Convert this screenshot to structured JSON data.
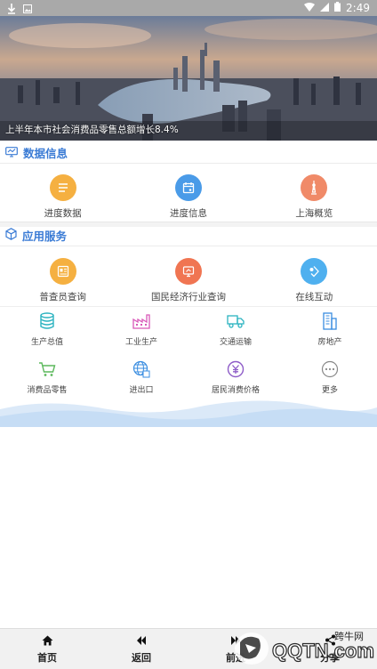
{
  "status": {
    "time": "2:49"
  },
  "banner": {
    "caption": "上半年本市社会消费品零售总额增长8.4%"
  },
  "sections": {
    "data_info": {
      "title": "数据信息"
    },
    "services": {
      "title": "应用服务"
    }
  },
  "data_info_items": [
    {
      "label": "进度数据",
      "icon": "document-icon",
      "color": "#f5b041"
    },
    {
      "label": "进度信息",
      "icon": "calendar-icon",
      "color": "#4a9be8"
    },
    {
      "label": "上海概览",
      "icon": "tower-icon",
      "color": "#f08a68"
    }
  ],
  "service_items": [
    {
      "label": "普查员查询",
      "icon": "id-card-icon",
      "color": "#f5b041"
    },
    {
      "label": "国民经济行业查询",
      "icon": "monitor-icon",
      "color": "#f07552"
    },
    {
      "label": "在线互动",
      "icon": "chat-icon",
      "color": "#4fb0ef"
    }
  ],
  "grid_items": [
    {
      "label": "生产总值",
      "icon": "database-icon",
      "color": "#2bb3c0"
    },
    {
      "label": "工业生产",
      "icon": "factory-icon",
      "color": "#d957b8"
    },
    {
      "label": "交通运输",
      "icon": "truck-icon",
      "color": "#2bb3c0"
    },
    {
      "label": "房地产",
      "icon": "building-icon",
      "color": "#3a8de0"
    },
    {
      "label": "消费品零售",
      "icon": "cart-icon",
      "color": "#5cb85c"
    },
    {
      "label": "进出口",
      "icon": "globe-icon",
      "color": "#3a8de0"
    },
    {
      "label": "居民消费价格",
      "icon": "yuan-icon",
      "color": "#8e5cc8"
    },
    {
      "label": "更多",
      "icon": "more-icon",
      "color": "#888888"
    }
  ],
  "nav": {
    "home": "首页",
    "back": "返回",
    "forward": "前进",
    "share": "分享"
  },
  "watermark": {
    "site": "跨牛网",
    "brand": "QQTN.com"
  }
}
